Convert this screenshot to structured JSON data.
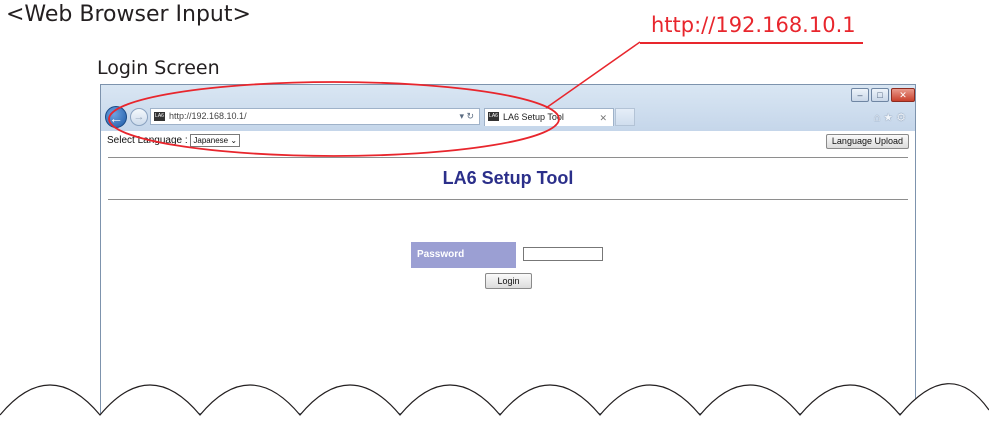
{
  "annotations": {
    "heading": "<Web Browser Input>",
    "screen_label": "Login Screen",
    "url_callout": "http://192.168.10.1"
  },
  "browser": {
    "address_url": "http://192.168.10.1/",
    "tab_title": "LA6 Setup Tool",
    "favicon_text": "LA6"
  },
  "page": {
    "select_language_label": "Select Language : ",
    "language_value": "Japanese",
    "language_upload_label": "Language Upload",
    "app_title": "LA6 Setup Tool",
    "password_label": "Password",
    "password_value": "",
    "login_label": "Login"
  },
  "colors": {
    "callout": "#e8262d",
    "title": "#2b2f8a",
    "password_label_bg": "#9b9fd3"
  }
}
